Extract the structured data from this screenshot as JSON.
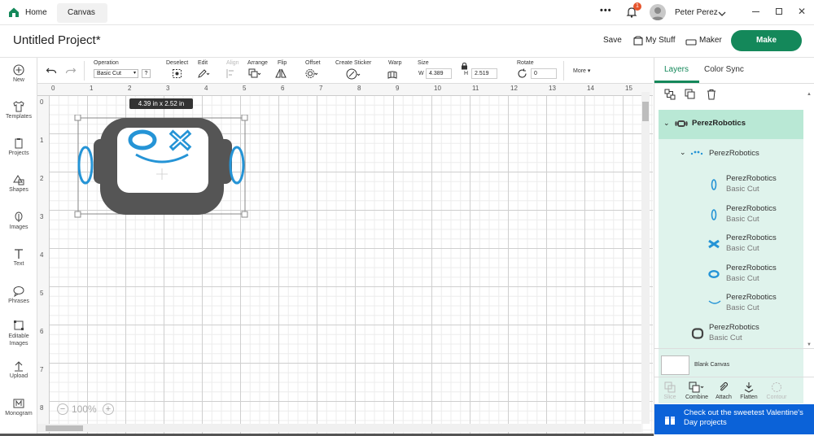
{
  "titlebar": {
    "tabs": [
      {
        "label": "Home"
      },
      {
        "label": "Canvas"
      }
    ],
    "more": "•••",
    "notification_count": "1",
    "user_name": "Peter Perez",
    "window_controls": [
      "minimize",
      "restore",
      "close"
    ]
  },
  "project": {
    "title": "Untitled Project*",
    "save_label": "Save",
    "mystuff_label": "My Stuff",
    "maker_label": "Maker",
    "make_label": "Make"
  },
  "toolbar": {
    "operation_label": "Operation",
    "operation_value": "Basic Cut",
    "help": "?",
    "deselect_label": "Deselect",
    "edit_label": "Edit",
    "align_label": "Align",
    "arrange_label": "Arrange",
    "flip_label": "Flip",
    "offset_label": "Offset",
    "create_sticker_label": "Create Sticker",
    "warp_label": "Warp",
    "size_label": "Size",
    "w_label": "W",
    "w_value": "4.389",
    "h_label": "H",
    "h_value": "2.519",
    "rotate_label": "Rotate",
    "rotate_value": "0",
    "more_label": "More"
  },
  "leftbar": {
    "items": [
      {
        "label": "New"
      },
      {
        "label": "Templates"
      },
      {
        "label": "Projects"
      },
      {
        "label": "Shapes"
      },
      {
        "label": "Images"
      },
      {
        "label": "Text"
      },
      {
        "label": "Phrases"
      },
      {
        "label": "Editable Images"
      },
      {
        "label": "Upload"
      },
      {
        "label": "Monogram"
      }
    ]
  },
  "canvas": {
    "size_tooltip": "4.39  in x 2.52  in",
    "zoom": "100%",
    "ruler_top": [
      "0",
      "1",
      "2",
      "3",
      "4",
      "5",
      "6",
      "7",
      "8",
      "9",
      "10",
      "11",
      "12",
      "13",
      "14",
      "15"
    ],
    "ruler_left": [
      "0",
      "1",
      "2",
      "3",
      "4",
      "5",
      "6",
      "7",
      "8"
    ]
  },
  "panel": {
    "tabs": [
      {
        "label": "Layers"
      },
      {
        "label": "Color Sync"
      }
    ],
    "group_name": "PerezRobotics",
    "subgroup_name": "PerezRobotics",
    "layers": [
      {
        "name": "PerezRobotics",
        "op": "Basic Cut",
        "icon": "ear-oval-icon"
      },
      {
        "name": "PerezRobotics",
        "op": "Basic Cut",
        "icon": "ear-oval-icon"
      },
      {
        "name": "PerezRobotics",
        "op": "Basic Cut",
        "icon": "x-eye-icon"
      },
      {
        "name": "PerezRobotics",
        "op": "Basic Cut",
        "icon": "o-eye-icon"
      },
      {
        "name": "PerezRobotics",
        "op": "Basic Cut",
        "icon": "smile-icon"
      }
    ],
    "base_layer": {
      "name": "PerezRobotics",
      "op": "Basic Cut"
    },
    "blank_canvas_label": "Blank Canvas",
    "actions": [
      {
        "label": "Slice"
      },
      {
        "label": "Combine"
      },
      {
        "label": "Attach"
      },
      {
        "label": "Flatten"
      },
      {
        "label": "Contour"
      }
    ],
    "promo": "Check out the sweetest Valentine's Day projects"
  },
  "colors": {
    "brand_green": "#14885a",
    "layer_highlight": "#d6f1e6",
    "shape_blue": "#2594d6",
    "shape_gray": "#555555",
    "promo_blue": "#0b62d8"
  }
}
